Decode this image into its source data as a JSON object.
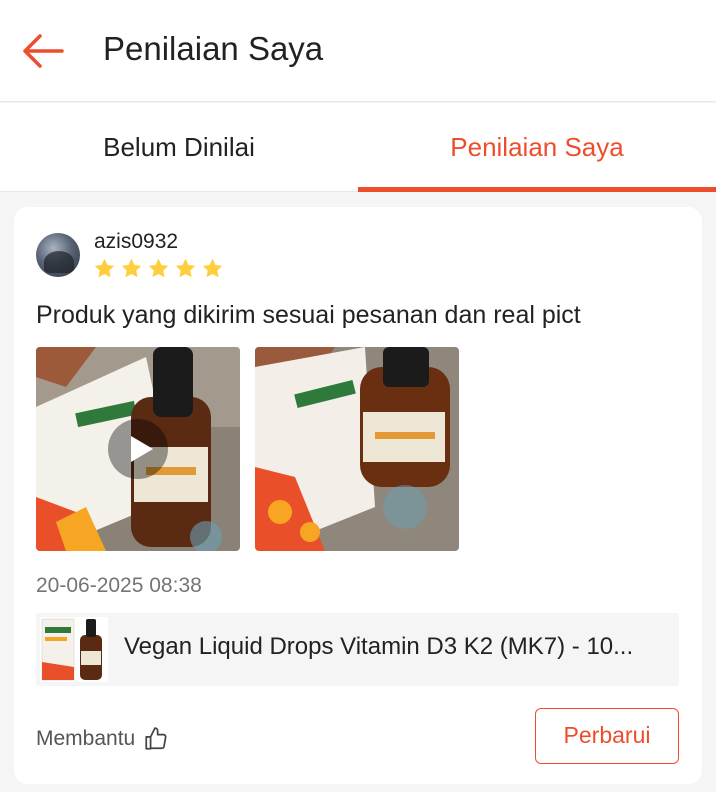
{
  "header": {
    "title": "Penilaian Saya",
    "back_icon": "arrow-left-icon",
    "accent": "#ee4d2d"
  },
  "tabs": [
    {
      "label": "Belum Dinilai",
      "active": false
    },
    {
      "label": "Penilaian Saya",
      "active": true
    }
  ],
  "review": {
    "username": "azis0932",
    "rating": 5,
    "rating_max": 5,
    "text": "Produk yang dikirim sesuai pesanan dan real pict",
    "media": [
      {
        "type": "video",
        "icon": "play-icon"
      },
      {
        "type": "photo"
      }
    ],
    "timestamp": "20-06-2025 08:38",
    "product": {
      "name": "Vegan Liquid Drops Vitamin D3 K2 (MK7) - 10..."
    },
    "helpful_label": "Membantu",
    "helpful_icon": "thumbs-up-icon",
    "update_label": "Perbarui"
  },
  "colors": {
    "star": "#ffce3d",
    "muted_text": "#757575"
  }
}
